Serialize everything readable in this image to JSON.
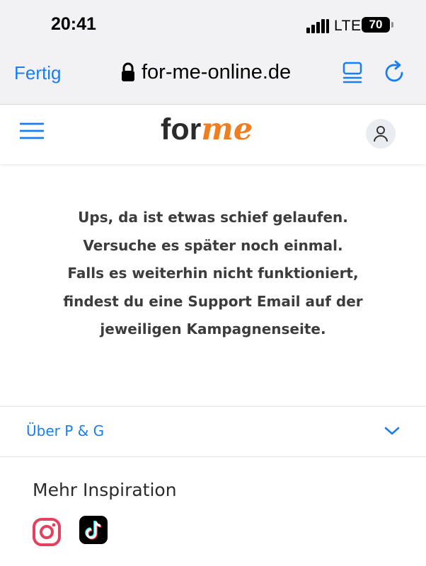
{
  "status_bar": {
    "time": "20:41",
    "network": "LTE",
    "battery": "70"
  },
  "browser": {
    "done_label": "Fertig",
    "url": "for-me-online.de"
  },
  "header": {
    "logo_for": "for",
    "logo_me": "me"
  },
  "error": {
    "lines": [
      "Ups, da ist etwas schief gelaufen.",
      "Versuche es später noch einmal.",
      "Falls es weiterhin nicht funktioniert,",
      "findest du eine Support Email auf der",
      "jeweiligen Kampagnenseite."
    ]
  },
  "footer": {
    "accordion_label": "Über P & G",
    "more_title": "Mehr Inspiration",
    "social": [
      "instagram-icon",
      "tiktok-icon"
    ]
  },
  "colors": {
    "accent": "#1a7ef2",
    "brand_orange": "#f07d1f",
    "text_dark": "#3c3c3c"
  }
}
